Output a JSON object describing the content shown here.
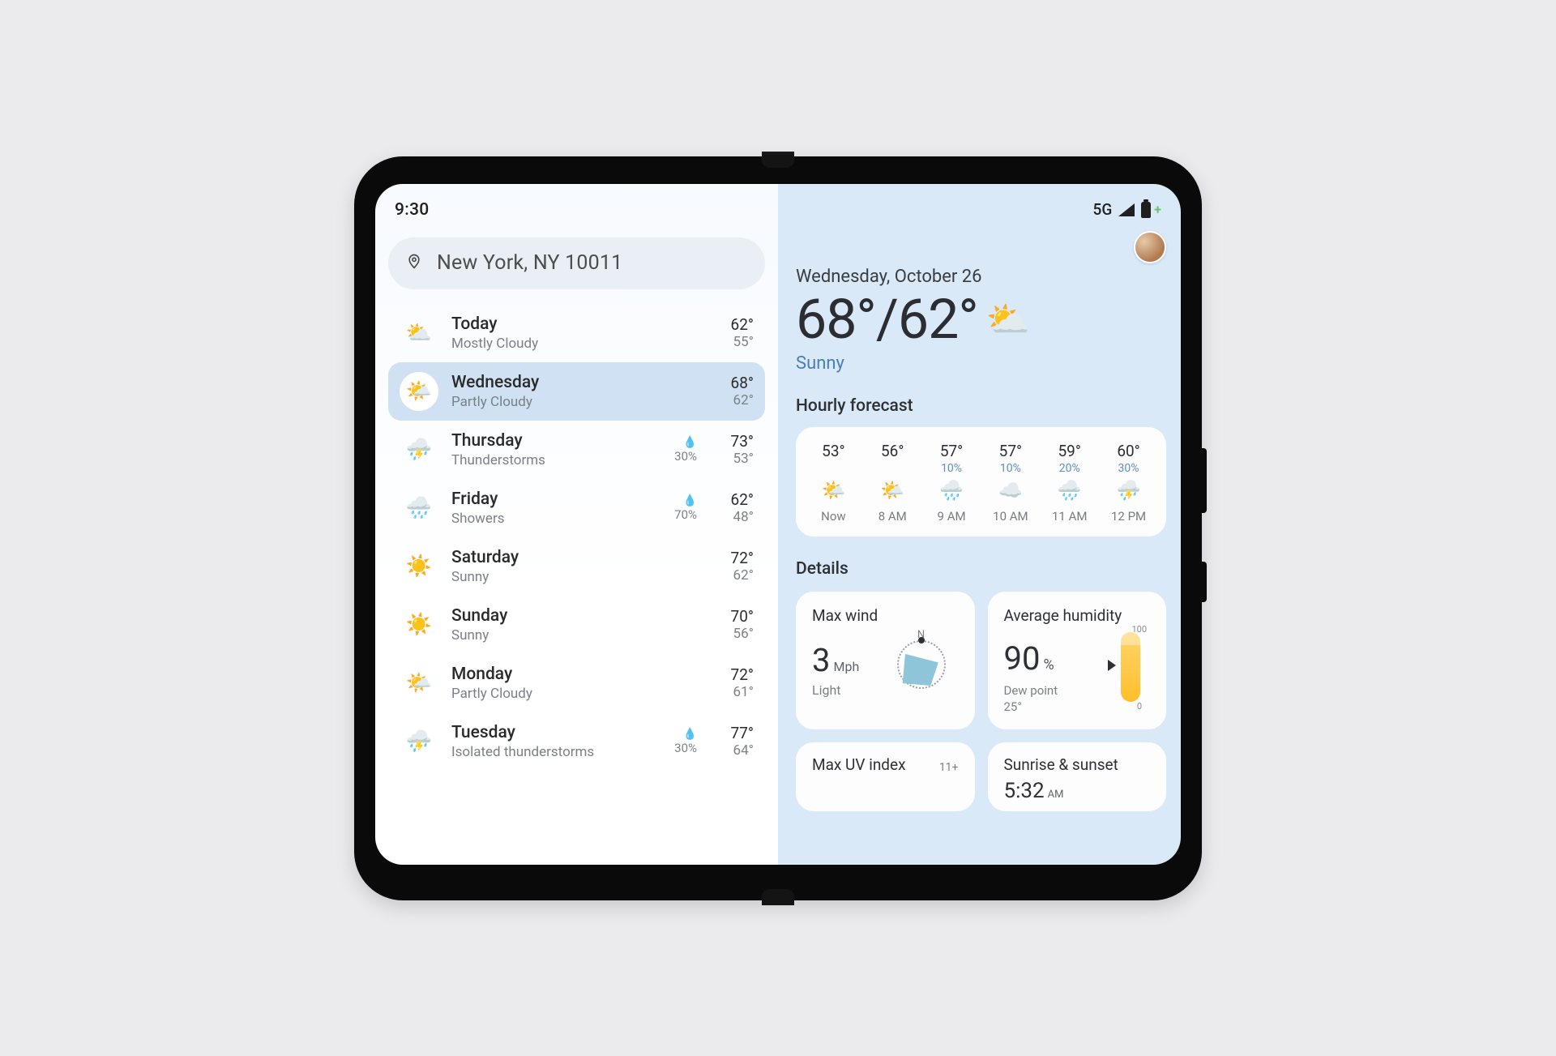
{
  "status": {
    "time": "9:30",
    "network": "5G"
  },
  "search": {
    "location": "New York, NY 10011"
  },
  "days": [
    {
      "name": "Today",
      "cond": "Mostly Cloudy",
      "high": "62°",
      "low": "55°",
      "icon": "⛅",
      "chance": "",
      "selected": false
    },
    {
      "name": "Wednesday",
      "cond": "Partly Cloudy",
      "high": "68°",
      "low": "62°",
      "icon": "🌤️",
      "chance": "",
      "selected": true
    },
    {
      "name": "Thursday",
      "cond": "Thunderstorms",
      "high": "73°",
      "low": "53°",
      "icon": "⛈️",
      "chance": "30%",
      "selected": false
    },
    {
      "name": "Friday",
      "cond": "Showers",
      "high": "62°",
      "low": "48°",
      "icon": "🌧️",
      "chance": "70%",
      "selected": false
    },
    {
      "name": "Saturday",
      "cond": "Sunny",
      "high": "72°",
      "low": "62°",
      "icon": "☀️",
      "chance": "",
      "selected": false
    },
    {
      "name": "Sunday",
      "cond": "Sunny",
      "high": "70°",
      "low": "56°",
      "icon": "☀️",
      "chance": "",
      "selected": false
    },
    {
      "name": "Monday",
      "cond": "Partly Cloudy",
      "high": "72°",
      "low": "61°",
      "icon": "🌤️",
      "chance": "",
      "selected": false
    },
    {
      "name": "Tuesday",
      "cond": "Isolated thunderstorms",
      "high": "77°",
      "low": "64°",
      "icon": "⛈️",
      "chance": "30%",
      "selected": false
    }
  ],
  "current": {
    "date": "Wednesday, October 26",
    "temps": "68°/62°",
    "icon": "⛅",
    "cond": "Sunny"
  },
  "hourly": {
    "title": "Hourly forecast",
    "items": [
      {
        "temp": "53°",
        "chance": "",
        "icon": "🌤️",
        "label": "Now"
      },
      {
        "temp": "56°",
        "chance": "",
        "icon": "🌤️",
        "label": "8 AM"
      },
      {
        "temp": "57°",
        "chance": "10%",
        "icon": "🌧️",
        "label": "9 AM"
      },
      {
        "temp": "57°",
        "chance": "10%",
        "icon": "☁️",
        "label": "10 AM"
      },
      {
        "temp": "59°",
        "chance": "20%",
        "icon": "🌧️",
        "label": "11 AM"
      },
      {
        "temp": "60°",
        "chance": "30%",
        "icon": "⛈️",
        "label": "12 PM"
      }
    ]
  },
  "details": {
    "title": "Details",
    "wind": {
      "title": "Max wind",
      "value": "3",
      "unit": "Mph",
      "desc": "Light",
      "dir": "N"
    },
    "humidity": {
      "title": "Average humidity",
      "value": "90",
      "pct": "%",
      "sub1": "Dew point",
      "sub2": "25°",
      "scaleTop": "100",
      "scaleBot": "0"
    },
    "uv": {
      "title": "Max UV index",
      "value": "11+"
    },
    "sun": {
      "title": "Sunrise & sunset",
      "time": "5:32",
      "ampm": "AM"
    }
  }
}
